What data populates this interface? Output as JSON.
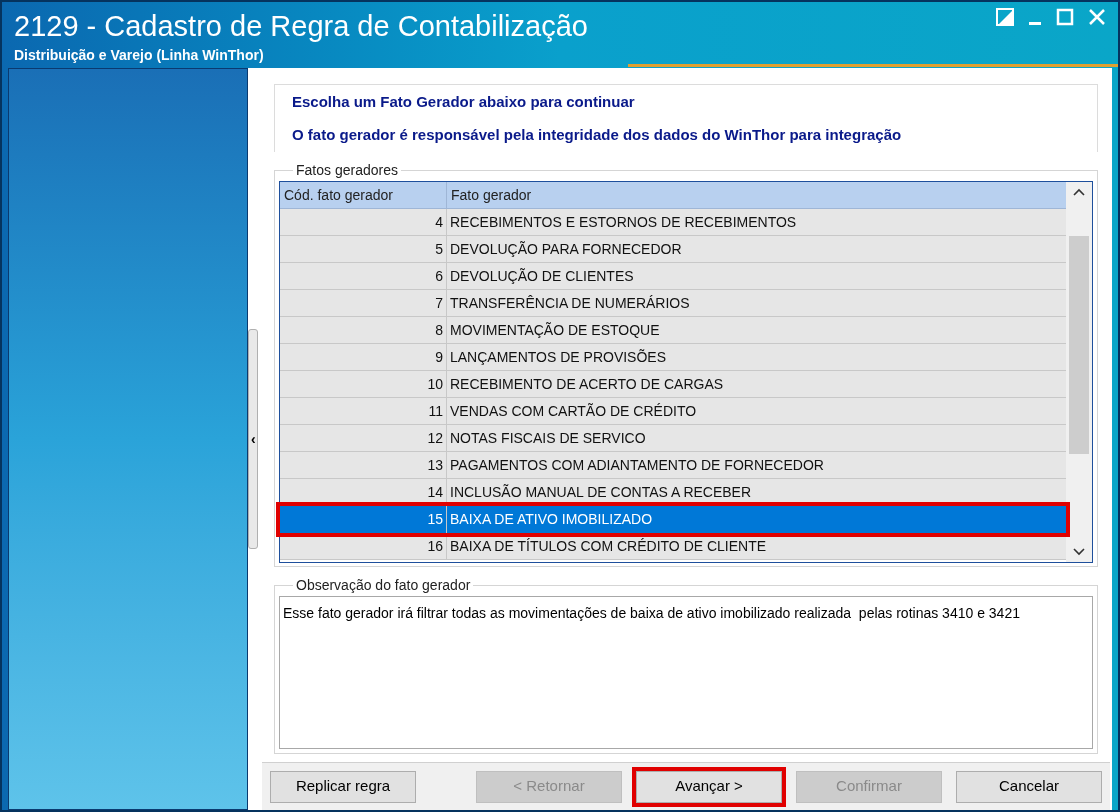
{
  "window": {
    "title": "2129 - Cadastro de Regra de Contabilização",
    "subtitle": "Distribuição e Varejo (Linha WinThor)"
  },
  "sidebar_toggle": "‹",
  "instructions": [
    "Escolha um Fato Gerador abaixo para continuar",
    "O fato gerador é responsável pela integridade dos dados do WinThor para integração"
  ],
  "fatos_geradores": {
    "label": "Fatos geradores",
    "columns": [
      "Cód. fato gerador",
      "Fato gerador"
    ],
    "rows": [
      {
        "code": "4",
        "name": "RECEBIMENTOS E ESTORNOS DE RECEBIMENTOS",
        "selected": false,
        "highlighted": false
      },
      {
        "code": "5",
        "name": "DEVOLUÇÃO PARA FORNECEDOR",
        "selected": false,
        "highlighted": false
      },
      {
        "code": "6",
        "name": "DEVOLUÇÃO DE CLIENTES",
        "selected": false,
        "highlighted": false
      },
      {
        "code": "7",
        "name": "TRANSFERÊNCIA DE NUMERÁRIOS",
        "selected": false,
        "highlighted": false
      },
      {
        "code": "8",
        "name": "MOVIMENTAÇÃO DE ESTOQUE",
        "selected": false,
        "highlighted": false
      },
      {
        "code": "9",
        "name": "LANÇAMENTOS DE PROVISÕES",
        "selected": false,
        "highlighted": false
      },
      {
        "code": "10",
        "name": "RECEBIMENTO DE ACERTO DE CARGAS",
        "selected": false,
        "highlighted": false
      },
      {
        "code": "11",
        "name": "VENDAS COM CARTÃO DE CRÉDITO",
        "selected": false,
        "highlighted": false
      },
      {
        "code": "12",
        "name": "NOTAS FISCAIS DE SERVICO",
        "selected": false,
        "highlighted": false
      },
      {
        "code": "13",
        "name": "PAGAMENTOS COM ADIANTAMENTO DE FORNECEDOR",
        "selected": false,
        "highlighted": false
      },
      {
        "code": "14",
        "name": "INCLUSÃO MANUAL DE CONTAS A RECEBER",
        "selected": false,
        "highlighted": false
      },
      {
        "code": "15",
        "name": "BAIXA DE ATIVO IMOBILIZADO",
        "selected": true,
        "highlighted": true
      },
      {
        "code": "16",
        "name": "BAIXA DE TÍTULOS COM CRÉDITO DE CLIENTE",
        "selected": false,
        "highlighted": false
      }
    ]
  },
  "observacao": {
    "label": "Observação do fato gerador",
    "text": "Esse fato gerador irá filtrar todas as movimentações de baixa de ativo imobilizado realizada  pelas rotinas 3410 e 3421"
  },
  "buttons": [
    {
      "label": "Replicar regra",
      "disabled": false,
      "highlighted": false
    },
    {
      "label": "< Retornar",
      "disabled": true,
      "highlighted": false
    },
    {
      "label": "Avançar >",
      "disabled": false,
      "highlighted": true
    },
    {
      "label": "Confirmar",
      "disabled": true,
      "highlighted": false
    },
    {
      "label": "Cancelar",
      "disabled": false,
      "highlighted": false
    }
  ]
}
